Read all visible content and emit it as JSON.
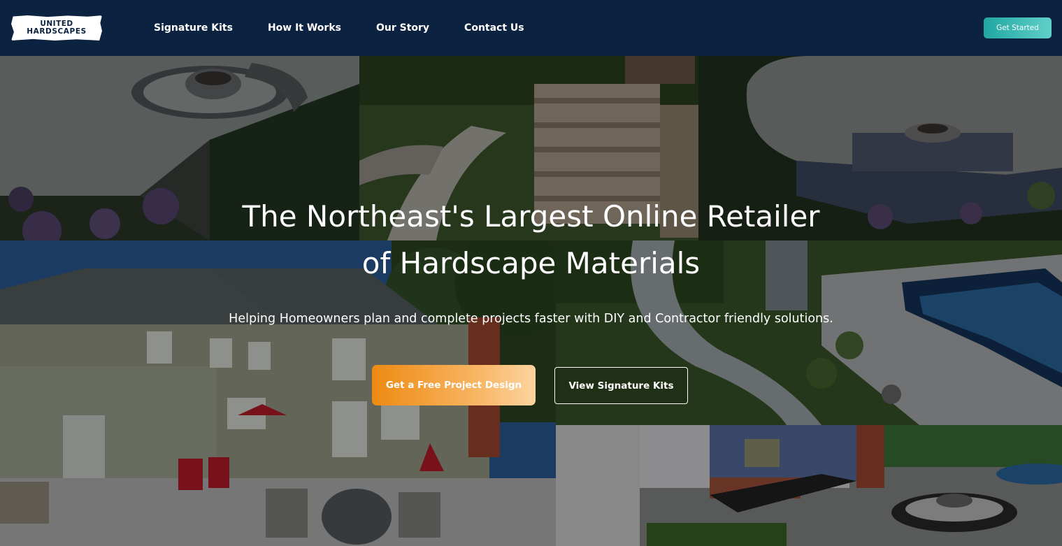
{
  "logo": {
    "line1": "UNITED",
    "line2": "HARDSCAPES"
  },
  "nav": {
    "items": [
      {
        "label": "Signature Kits"
      },
      {
        "label": "How It Works"
      },
      {
        "label": "Our Story"
      },
      {
        "label": "Contact Us"
      }
    ],
    "cta_label": "Get Started"
  },
  "hero": {
    "title_line1": "The Northeast's Largest Online Retailer",
    "title_line2": "of Hardscape Materials",
    "subtitle": "Helping Homeowners plan and complete projects faster with DIY and Contractor friendly solutions.",
    "primary_button": "Get a Free Project Design",
    "secondary_button": "View Signature Kits"
  },
  "colors": {
    "navbar_bg": "#0b2240",
    "accent_teal": "#21a6a2",
    "accent_orange": "#ee8a12"
  }
}
